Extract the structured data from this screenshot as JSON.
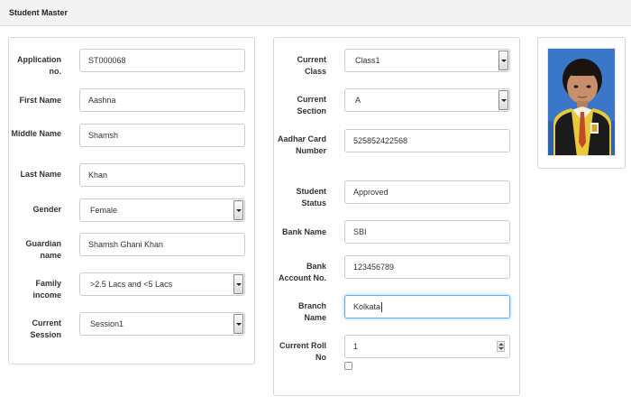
{
  "header": {
    "title": "Student Master"
  },
  "left": {
    "application_no": {
      "label": "Application no.",
      "value": "ST000068"
    },
    "first_name": {
      "label": "First Name",
      "value": "Aashna"
    },
    "middle_name": {
      "label": "Middle Name",
      "value": "Shamsh"
    },
    "last_name": {
      "label": "Last Name",
      "value": "Khan"
    },
    "gender": {
      "label": "Gender",
      "value": "Female"
    },
    "guardian_name": {
      "label": "Guardian name",
      "value": "Shamsh Ghani Khan"
    },
    "family_income": {
      "label": "Family income",
      "value": ">2.5 Lacs and <5 Lacs"
    },
    "current_session": {
      "label": "Current Session",
      "value": "Session1"
    }
  },
  "middle": {
    "current_class": {
      "label": "Current Class",
      "value": "Class1"
    },
    "current_section": {
      "label": "Current Section",
      "value": "A"
    },
    "aadhar": {
      "label": "Aadhar Card Number",
      "value": "525852422568"
    },
    "student_status": {
      "label": "Student Status",
      "value": "Approved"
    },
    "bank_name": {
      "label": "Bank Name",
      "value": "SBI"
    },
    "bank_account": {
      "label": "Bank Account No.",
      "value": "123456789"
    },
    "branch_name": {
      "label": "Branch Name",
      "value": "Kolkata"
    },
    "current_roll_no": {
      "label": "Current Roll No",
      "value": "1"
    }
  },
  "icons": {
    "select_arrow": "chevron-down-icon",
    "spinner": "spinner-arrows-icon",
    "photo": "student-photo"
  },
  "colors": {
    "focus_border": "#66afe9",
    "panel_border": "#d6d6d6",
    "header_bg": "#f3f3f3"
  }
}
